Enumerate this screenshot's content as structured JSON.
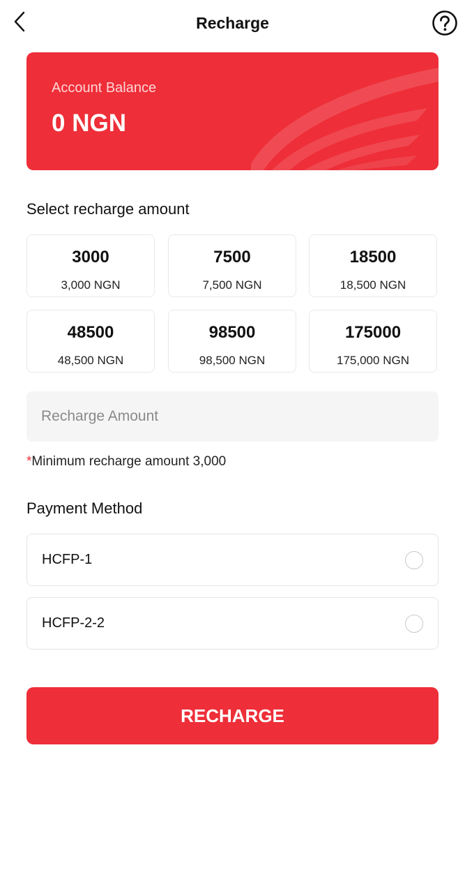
{
  "header": {
    "title": "Recharge"
  },
  "balance": {
    "label": "Account Balance",
    "value": "0 NGN"
  },
  "select_amount": {
    "title": "Select recharge amount",
    "options": [
      {
        "amount": "3000",
        "formatted": "3,000 NGN"
      },
      {
        "amount": "7500",
        "formatted": "7,500 NGN"
      },
      {
        "amount": "18500",
        "formatted": "18,500 NGN"
      },
      {
        "amount": "48500",
        "formatted": "48,500 NGN"
      },
      {
        "amount": "98500",
        "formatted": "98,500 NGN"
      },
      {
        "amount": "175000",
        "formatted": "175,000 NGN"
      }
    ]
  },
  "amount_input": {
    "placeholder": "Recharge Amount",
    "value": ""
  },
  "min_note": {
    "asterisk": "*",
    "text": "Minimum recharge amount 3,000"
  },
  "payment": {
    "title": "Payment Method",
    "methods": [
      {
        "label": "HCFP-1",
        "selected": false
      },
      {
        "label": "HCFP-2-2",
        "selected": false
      }
    ]
  },
  "submit": {
    "label": "RECHARGE"
  },
  "colors": {
    "accent": "#ee2e38",
    "card_border": "#e9e9e9",
    "input_bg": "#f5f5f5"
  },
  "icons": {
    "back": "chevron-left-icon",
    "help": "question-circle-icon",
    "radio": "radio-unchecked-icon"
  }
}
